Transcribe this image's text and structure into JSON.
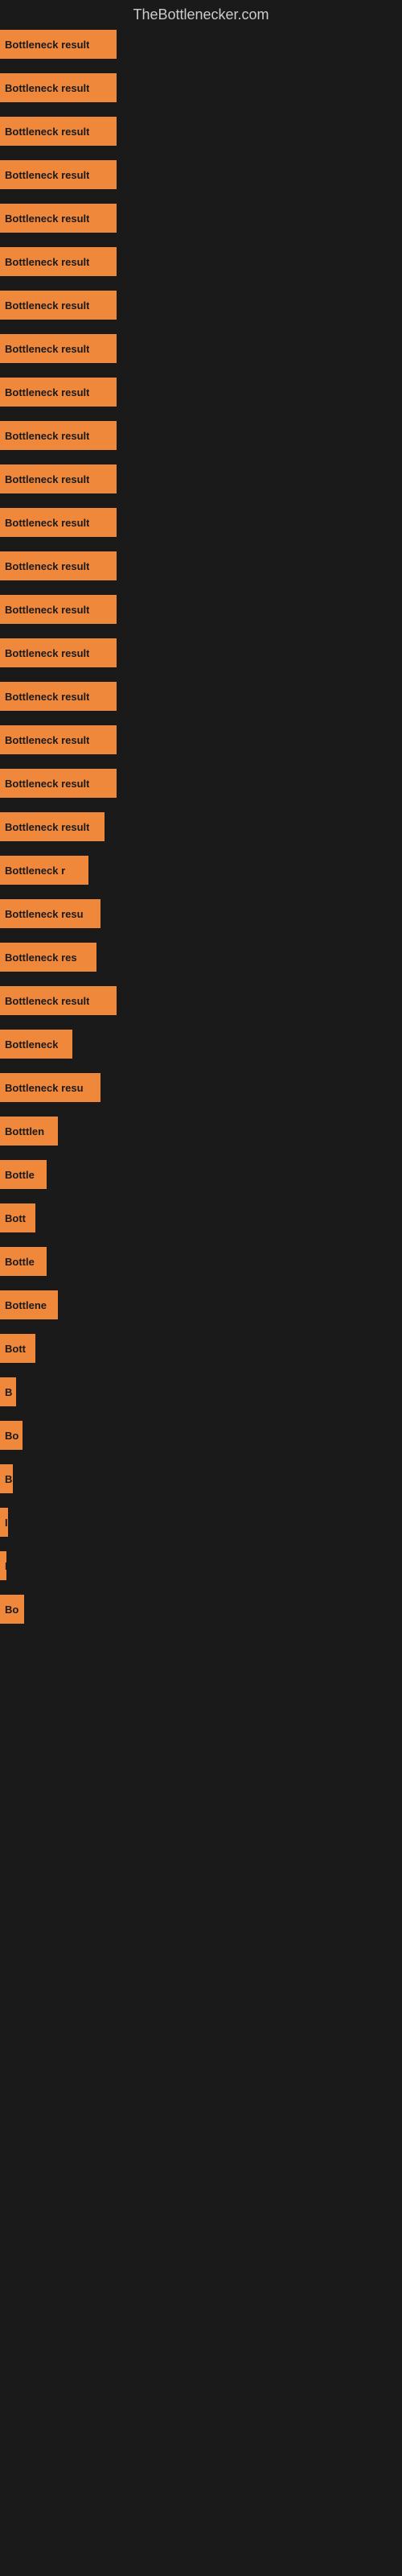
{
  "site": {
    "title": "TheBottlenecker.com"
  },
  "bars": [
    {
      "label": "Bottleneck result",
      "width": 145,
      "gap": 18
    },
    {
      "label": "Bottleneck result",
      "width": 145,
      "gap": 18
    },
    {
      "label": "Bottleneck result",
      "width": 145,
      "gap": 18
    },
    {
      "label": "Bottleneck result",
      "width": 145,
      "gap": 18
    },
    {
      "label": "Bottleneck result",
      "width": 145,
      "gap": 18
    },
    {
      "label": "Bottleneck result",
      "width": 145,
      "gap": 18
    },
    {
      "label": "Bottleneck result",
      "width": 145,
      "gap": 18
    },
    {
      "label": "Bottleneck result",
      "width": 145,
      "gap": 18
    },
    {
      "label": "Bottleneck result",
      "width": 145,
      "gap": 18
    },
    {
      "label": "Bottleneck result",
      "width": 145,
      "gap": 18
    },
    {
      "label": "Bottleneck result",
      "width": 145,
      "gap": 18
    },
    {
      "label": "Bottleneck result",
      "width": 145,
      "gap": 18
    },
    {
      "label": "Bottleneck result",
      "width": 145,
      "gap": 18
    },
    {
      "label": "Bottleneck result",
      "width": 145,
      "gap": 18
    },
    {
      "label": "Bottleneck result",
      "width": 145,
      "gap": 18
    },
    {
      "label": "Bottleneck result",
      "width": 145,
      "gap": 18
    },
    {
      "label": "Bottleneck result",
      "width": 145,
      "gap": 18
    },
    {
      "label": "Bottleneck result",
      "width": 145,
      "gap": 18
    },
    {
      "label": "Bottleneck result",
      "width": 130,
      "gap": 18
    },
    {
      "label": "Bottleneck r",
      "width": 110,
      "gap": 18
    },
    {
      "label": "Bottleneck resu",
      "width": 125,
      "gap": 18
    },
    {
      "label": "Bottleneck res",
      "width": 120,
      "gap": 18
    },
    {
      "label": "Bottleneck result",
      "width": 145,
      "gap": 18
    },
    {
      "label": "Bottleneck",
      "width": 90,
      "gap": 18
    },
    {
      "label": "Bottleneck resu",
      "width": 125,
      "gap": 18
    },
    {
      "label": "Botttlen",
      "width": 72,
      "gap": 18
    },
    {
      "label": "Bottle",
      "width": 58,
      "gap": 18
    },
    {
      "label": "Bott",
      "width": 44,
      "gap": 18
    },
    {
      "label": "Bottle",
      "width": 58,
      "gap": 18
    },
    {
      "label": "Bottlene",
      "width": 72,
      "gap": 18
    },
    {
      "label": "Bott",
      "width": 44,
      "gap": 18
    },
    {
      "label": "B",
      "width": 20,
      "gap": 18
    },
    {
      "label": "Bo",
      "width": 28,
      "gap": 18
    },
    {
      "label": "B",
      "width": 16,
      "gap": 18
    },
    {
      "label": "I",
      "width": 10,
      "gap": 18
    },
    {
      "label": "I",
      "width": 8,
      "gap": 18
    },
    {
      "label": "Bo",
      "width": 30,
      "gap": 0
    }
  ]
}
